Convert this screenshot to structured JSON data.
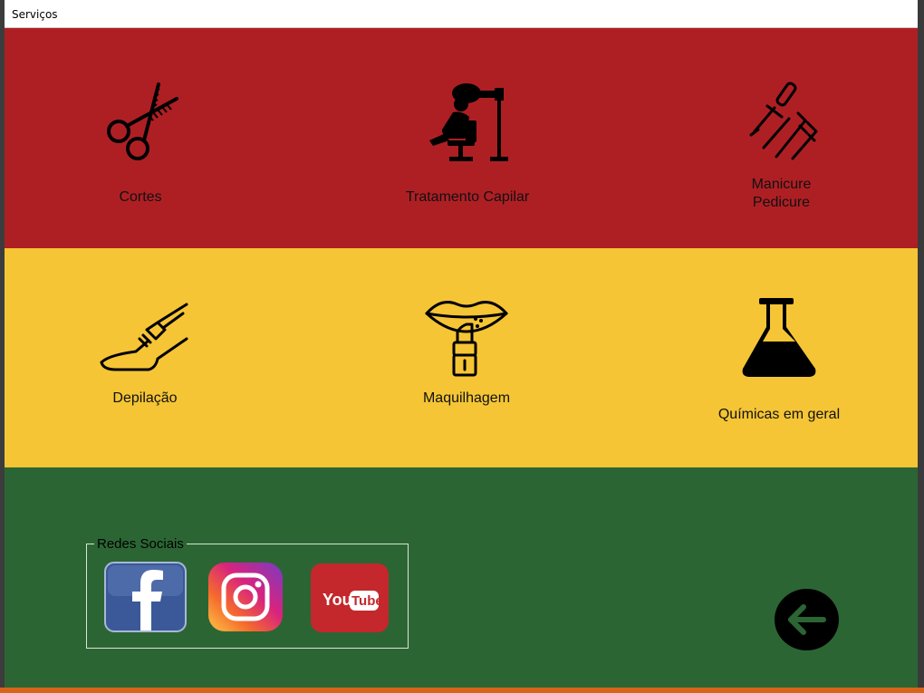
{
  "window": {
    "title": "Serviços"
  },
  "services": {
    "cortes": {
      "label": "Cortes",
      "icon": "scissors-icon"
    },
    "tratamento": {
      "label": "Tratamento Capilar",
      "icon": "hair-dryer-chair-icon"
    },
    "manicure": {
      "label_line1": "Manicure",
      "label_line2": "Pedicure",
      "icon": "nail-polish-icon"
    },
    "depilacao": {
      "label": "Depilação",
      "icon": "leg-razor-icon"
    },
    "maquilhagem": {
      "label": "Maquilhagem",
      "icon": "lips-lipstick-icon"
    },
    "quimicas": {
      "label": "Químicas em geral",
      "icon": "flask-icon"
    }
  },
  "social": {
    "legend": "Redes Sociais",
    "facebook_icon": "facebook-icon",
    "instagram_icon": "instagram-icon",
    "youtube_icon": "youtube-icon",
    "youtube_you": "You",
    "youtube_tube": "Tube"
  },
  "back": {
    "icon": "arrow-left-icon"
  },
  "colors": {
    "red_band": "#ae1f24",
    "yellow_band": "#f5c535",
    "green_band": "#2c6534"
  }
}
